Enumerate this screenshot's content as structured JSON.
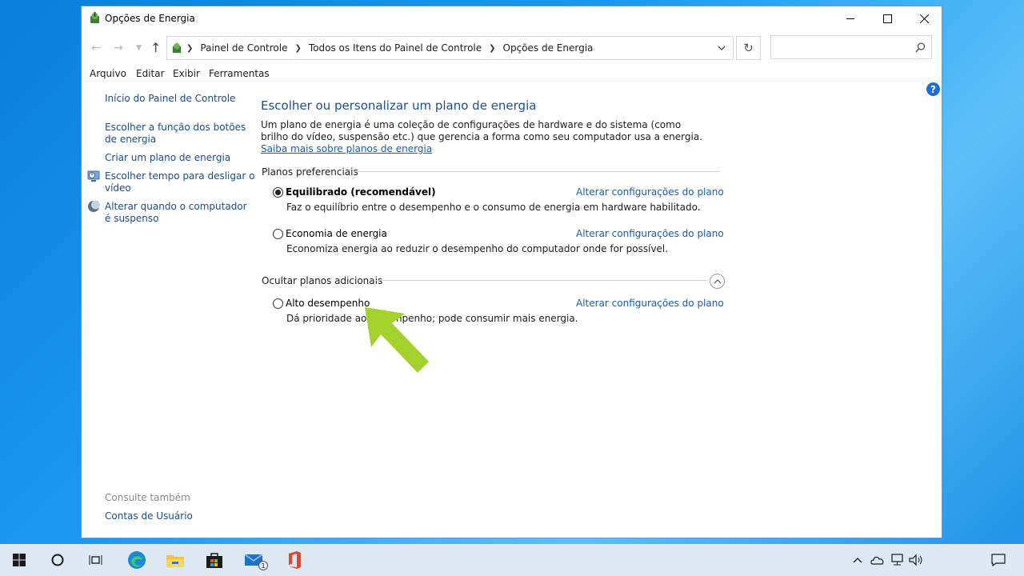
{
  "window": {
    "title": "Opções de Energia"
  },
  "address": {
    "crumbs": [
      "Painel de Controle",
      "Todos os Itens do Painel de Controle",
      "Opções de Energia"
    ],
    "search_placeholder": ""
  },
  "menu": {
    "file": "Arquivo",
    "edit": "Editar",
    "view": "Exibir",
    "tools": "Ferramentas"
  },
  "sidebar": {
    "home": "Início do Painel de Controle",
    "items": [
      {
        "label1": "Escolher a função dos botões",
        "label2": "de energia"
      },
      {
        "label1": "Criar um plano de energia",
        "label2": ""
      },
      {
        "label1": "Escolher tempo para desligar o",
        "label2": "vídeo"
      },
      {
        "label1": "Alterar quando o computador",
        "label2": "é suspenso"
      }
    ],
    "see_also": "Consulte também",
    "user_accounts": "Contas de Usuário"
  },
  "main": {
    "title": "Escolher ou personalizar um plano de energia",
    "desc_text": "Um plano de energia é uma coleção de configurações de hardware e do sistema (como brilho do vídeo, suspensão etc.) que gerencia a forma como seu computador usa a energia. ",
    "desc_link": "Saiba mais sobre planos de energia",
    "preferred_label": "Planos preferenciais",
    "hide_label": "Ocultar planos adicionais",
    "change_link": "Alterar configurações do plano",
    "plans": [
      {
        "name": "Equilibrado (recomendável)",
        "desc": "Faz o equilíbrio entre o desempenho e o consumo de energia em hardware habilitado.",
        "selected": true
      },
      {
        "name": "Economia de energia",
        "desc": "Economiza energia ao reduzir o desempenho do computador onde for possível.",
        "selected": false
      },
      {
        "name": "Alto desempenho",
        "desc": "Dá prioridade ao desempenho; pode consumir mais energia.",
        "selected": false
      }
    ]
  },
  "taskbar": {
    "mail_badge": "1"
  },
  "colors": {
    "accent_link": "#1a5cb3",
    "arrow": "#a4d22c"
  }
}
